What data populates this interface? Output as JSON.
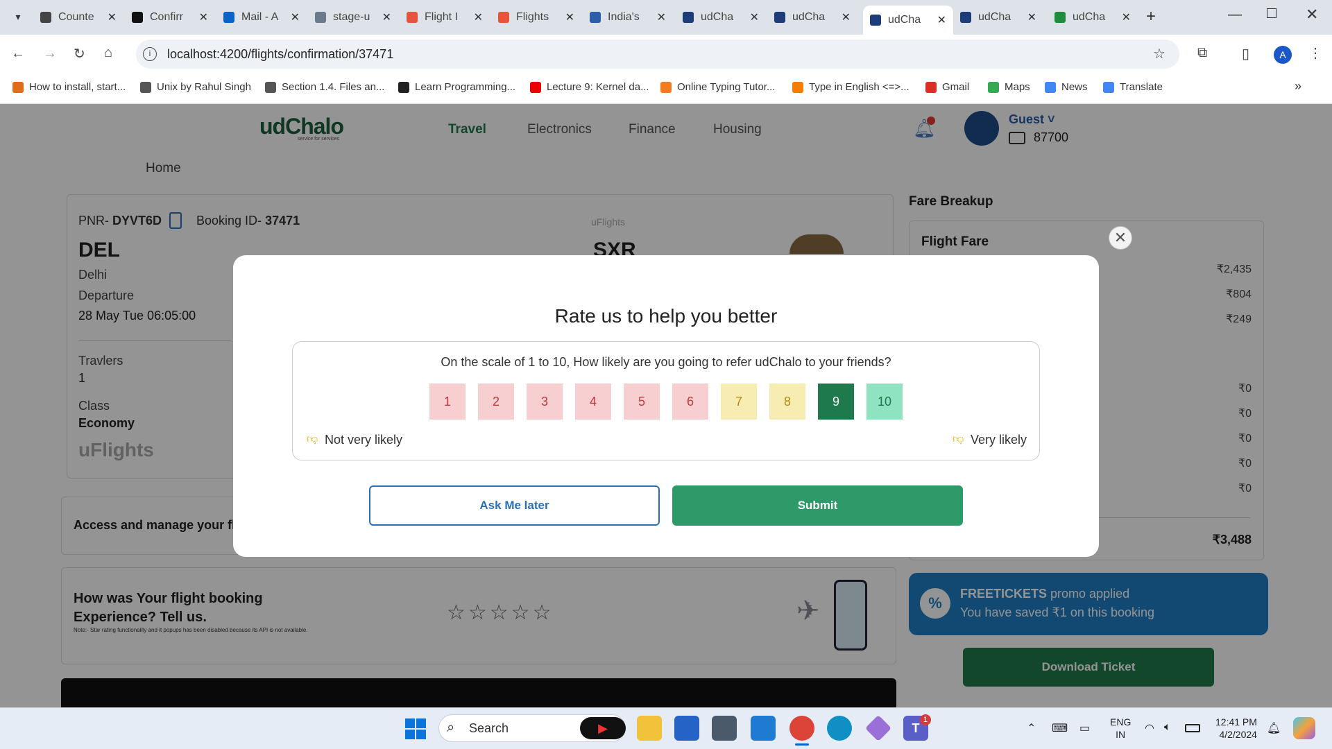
{
  "browser": {
    "tabs": [
      {
        "title": "Counte",
        "favicon": "chatgpt-icon",
        "color": "#444"
      },
      {
        "title": "Confirr",
        "favicon": "github-icon",
        "color": "#111"
      },
      {
        "title": "Mail - A",
        "favicon": "outlook-icon",
        "color": "#0a64c8"
      },
      {
        "title": "stage-u",
        "favicon": "u-icon",
        "color": "#6b7a8c"
      },
      {
        "title": "Flight I",
        "favicon": "figma-icon",
        "color": "#e8533b"
      },
      {
        "title": "Flights",
        "favicon": "figma-icon",
        "color": "#e8533b"
      },
      {
        "title": "India's",
        "favicon": "u-icon",
        "color": "#2b5fa8"
      },
      {
        "title": "udCha",
        "favicon": "nc-icon",
        "color": "#1d3c7a"
      },
      {
        "title": "udCha",
        "favicon": "nc-icon",
        "color": "#1d3c7a"
      },
      {
        "title": "udCha",
        "favicon": "nc-icon",
        "color": "#1d3c7a"
      },
      {
        "title": "udCha",
        "favicon": "nc-icon",
        "color": "#1d3c7a"
      },
      {
        "title": "udCha",
        "favicon": "sheets-icon",
        "color": "#1e8e3e"
      }
    ],
    "url": "localhost:4200/flights/confirmation/37471",
    "avatar_letter": "A",
    "bookmarks": [
      {
        "label": "How to install, start...",
        "icon": "w-icon",
        "color": "#e06b1a"
      },
      {
        "label": "Unix by Rahul Singh",
        "icon": "globe-icon",
        "color": "#555"
      },
      {
        "label": "Section 1.4.  Files an...",
        "icon": "globe-icon",
        "color": "#555"
      },
      {
        "label": "Learn Programming...",
        "icon": "circle-icon",
        "color": "#222"
      },
      {
        "label": "Lecture 9: Kernel da...",
        "icon": "youtube-icon",
        "color": "#e00"
      },
      {
        "label": "Online Typing Tutor...",
        "icon": "square-icon",
        "color": "#f47b20"
      },
      {
        "label": "Type in English <=>...",
        "icon": "blogger-icon",
        "color": "#f57d00"
      },
      {
        "label": "Gmail",
        "icon": "gmail-icon",
        "color": "#d93025"
      },
      {
        "label": "Maps",
        "icon": "maps-icon",
        "color": "#34a853"
      },
      {
        "label": "News",
        "icon": "news-icon",
        "color": "#4285f4"
      },
      {
        "label": "Translate",
        "icon": "translate-icon",
        "color": "#4285f4"
      }
    ]
  },
  "header": {
    "logo": "udChalo",
    "logo_tagline": "service for services",
    "nav": [
      "Travel",
      "Electronics",
      "Finance",
      "Housing"
    ],
    "user_name": "Guest",
    "wallet": "87700"
  },
  "breadcrumb": "Home",
  "booking": {
    "pnr_label": "PNR-",
    "pnr": "DYVT6D",
    "booking_id_label": "Booking ID-",
    "booking_id": "37471",
    "from_code": "DEL",
    "from_city": "Delhi",
    "departure_label": "Departure",
    "departure_time": "28 May Tue 06:05:00",
    "to_code": "SXR",
    "brand_small": "uFlights",
    "travellers_label": "Travlers",
    "travellers": "1",
    "class_label": "Class",
    "class_value": "Economy",
    "brand": "uFlights"
  },
  "manage_text": "Access and manage your fli",
  "experience": {
    "title": "How was Your flight booking Experience? Tell us.",
    "note": "Note:- Star rating functionality and it popups has been disabled because its API is not available."
  },
  "fare": {
    "heading": "Fare Breakup",
    "card_title": "Flight Fare",
    "amounts": [
      "₹2,435",
      "₹804",
      "₹249",
      "₹0",
      "₹0",
      "₹0",
      "₹0",
      "₹0"
    ],
    "total": "₹3,488"
  },
  "promo": {
    "code": "FREETICKETS",
    "applied": "promo applied",
    "saved": "You have saved ₹1 on this booking"
  },
  "download_label": "Download Ticket",
  "modal": {
    "title": "Rate us to help you better",
    "question": "On the scale of 1 to 10, How likely are you going to refer udChalo to your friends?",
    "scores": [
      {
        "value": "1",
        "bg": "#f8cfd0",
        "fg": "#c0393b"
      },
      {
        "value": "2",
        "bg": "#f8cfd0",
        "fg": "#c0393b"
      },
      {
        "value": "3",
        "bg": "#f8cfd0",
        "fg": "#c0393b"
      },
      {
        "value": "4",
        "bg": "#f8cfd0",
        "fg": "#c0393b"
      },
      {
        "value": "5",
        "bg": "#f8cfd0",
        "fg": "#c0393b"
      },
      {
        "value": "6",
        "bg": "#f8cfd0",
        "fg": "#c0393b"
      },
      {
        "value": "7",
        "bg": "#f7ecb2",
        "fg": "#b08a12"
      },
      {
        "value": "8",
        "bg": "#f7ecb2",
        "fg": "#b08a12"
      },
      {
        "value": "9",
        "bg": "#1e7a4c",
        "fg": "#ffffff"
      },
      {
        "value": "10",
        "bg": "#8fe3c0",
        "fg": "#1e7a4c"
      }
    ],
    "selected_score": "9",
    "low_label": "Not very likely",
    "high_label": "Very likely",
    "ask_later_label": "Ask Me later",
    "submit_label": "Submit"
  },
  "taskbar": {
    "search_placeholder": "Search",
    "lang_top": "ENG",
    "lang_bottom": "IN",
    "time": "12:41 PM",
    "date": "4/2/2024",
    "teams_badge": "1"
  }
}
